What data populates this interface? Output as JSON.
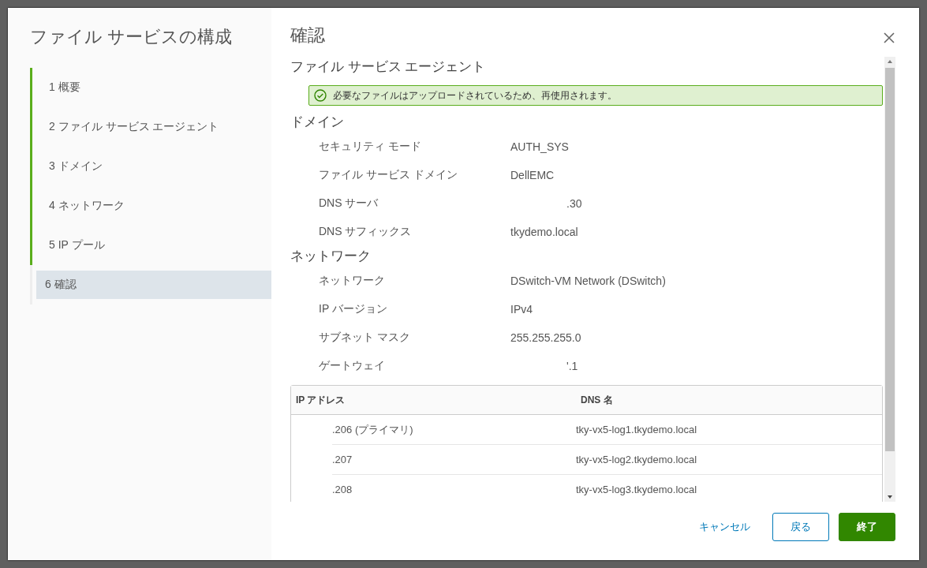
{
  "wizard": {
    "title": "ファイル サービスの構成",
    "steps": [
      {
        "label": "1 概要",
        "completed": true,
        "selected": false
      },
      {
        "label": "2 ファイル サービス エージェント",
        "completed": true,
        "selected": false
      },
      {
        "label": "3 ドメイン",
        "completed": true,
        "selected": false
      },
      {
        "label": "4 ネットワーク",
        "completed": true,
        "selected": false
      },
      {
        "label": "5 IP プール",
        "completed": true,
        "selected": false
      },
      {
        "label": "6 確認",
        "completed": false,
        "selected": true
      }
    ]
  },
  "page": {
    "title": "確認",
    "sections": [
      {
        "kind": "alert",
        "heading": "ファイル サービス エージェント",
        "message": "必要なファイルはアップロードされているため、再使用されます。"
      },
      {
        "kind": "fields",
        "heading": "ドメイン",
        "fields": [
          {
            "label": "セキュリティ モード",
            "value": "AUTH_SYS"
          },
          {
            "label": "ファイル サービス ドメイン",
            "value": "DellEMC"
          },
          {
            "label": "DNS サーバ",
            "value": ".30",
            "offset": true
          },
          {
            "label": "DNS サフィックス",
            "value": "tkydemo.local"
          }
        ]
      },
      {
        "kind": "fields",
        "heading": "ネットワーク",
        "fields": [
          {
            "label": "ネットワーク",
            "value": "DSwitch-VM Network (DSwitch)"
          },
          {
            "label": "IP バージョン",
            "value": "IPv4"
          },
          {
            "label": "サブネット マスク",
            "value": "255.255.255.0"
          },
          {
            "label": "ゲートウェイ",
            "value": "'.1",
            "offset": true
          }
        ]
      },
      {
        "kind": "table",
        "columns": [
          "IP アドレス",
          "DNS 名"
        ],
        "rows": [
          [
            ".206 (プライマリ)",
            "tky-vx5-log1.tkydemo.local"
          ],
          [
            ".207",
            "tky-vx5-log2.tkydemo.local"
          ],
          [
            ".208",
            "tky-vx5-log3.tkydemo.local"
          ]
        ]
      }
    ]
  },
  "buttons": [
    {
      "label": "キャンセル",
      "kind": "link"
    },
    {
      "label": "戻る",
      "kind": "outline"
    },
    {
      "label": "終了",
      "kind": "primary"
    }
  ]
}
